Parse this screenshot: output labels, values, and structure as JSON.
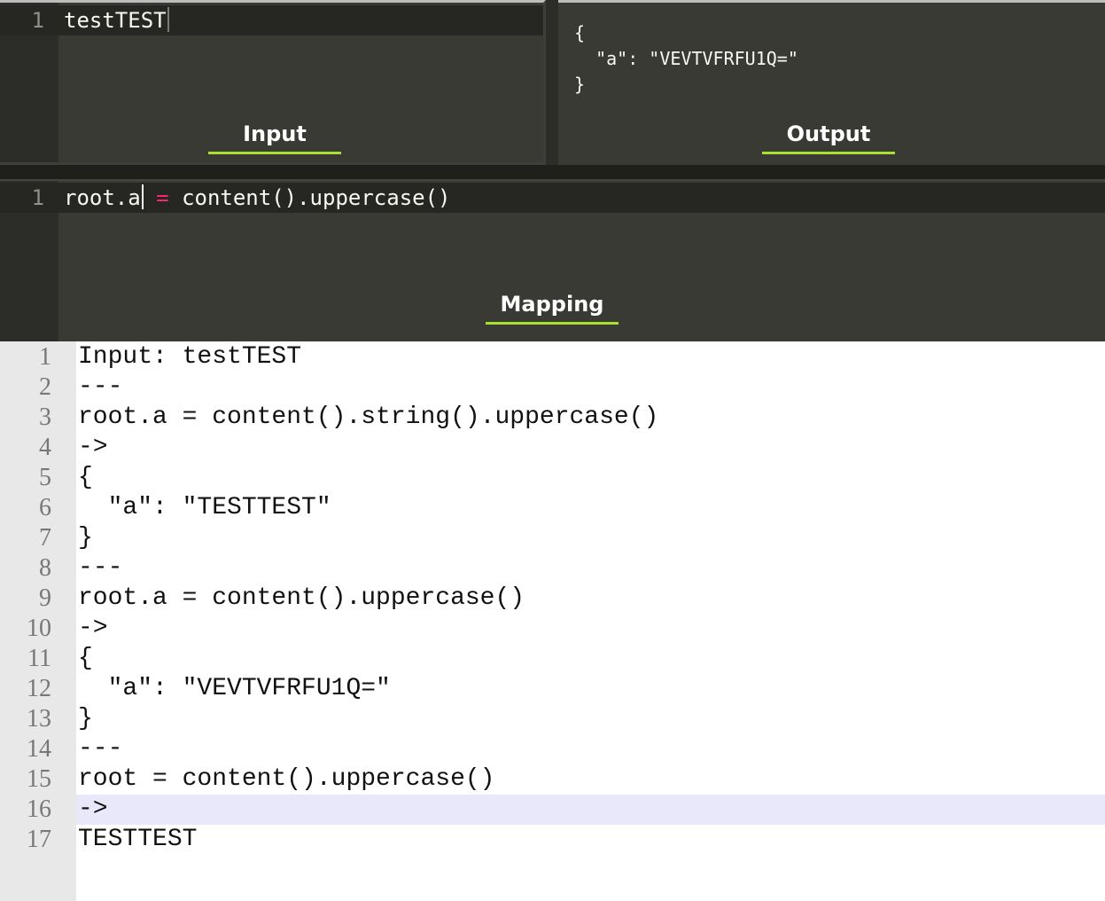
{
  "input_pane": {
    "label": "Input",
    "line_number": "1",
    "code": "testTEST"
  },
  "output_pane": {
    "label": "Output",
    "json_text": "{\n  \"a\": \"VEVTVFRFU1Q=\"\n}"
  },
  "mapping_pane": {
    "label": "Mapping",
    "line_number": "1",
    "code_left": "root.a",
    "code_op": "=",
    "code_right": "content().uppercase()"
  },
  "document": {
    "highlighted_line": 16,
    "lines": [
      {
        "n": "1",
        "text": "Input: testTEST"
      },
      {
        "n": "2",
        "text": "---"
      },
      {
        "n": "3",
        "text": "root.a = content().string().uppercase()"
      },
      {
        "n": "4",
        "text": "->"
      },
      {
        "n": "5",
        "text": "{"
      },
      {
        "n": "6",
        "text": "  \"a\": \"TESTTEST\""
      },
      {
        "n": "7",
        "text": "}"
      },
      {
        "n": "8",
        "text": "---"
      },
      {
        "n": "9",
        "text": "root.a = content().uppercase()"
      },
      {
        "n": "10",
        "text": "->"
      },
      {
        "n": "11",
        "text": "{"
      },
      {
        "n": "12",
        "text": "  \"a\": \"VEVTVFRFU1Q=\""
      },
      {
        "n": "13",
        "text": "}"
      },
      {
        "n": "14",
        "text": "---"
      },
      {
        "n": "15",
        "text": "root = content().uppercase()"
      },
      {
        "n": "16",
        "text": "->"
      },
      {
        "n": "17",
        "text": "TESTTEST"
      }
    ]
  },
  "colors": {
    "accent_underline": "#a6e22e",
    "operator": "#f92672",
    "editor_bg": "#393a34",
    "gutter_bg": "#2c2d28",
    "doc_highlight": "#e8e8fa"
  }
}
